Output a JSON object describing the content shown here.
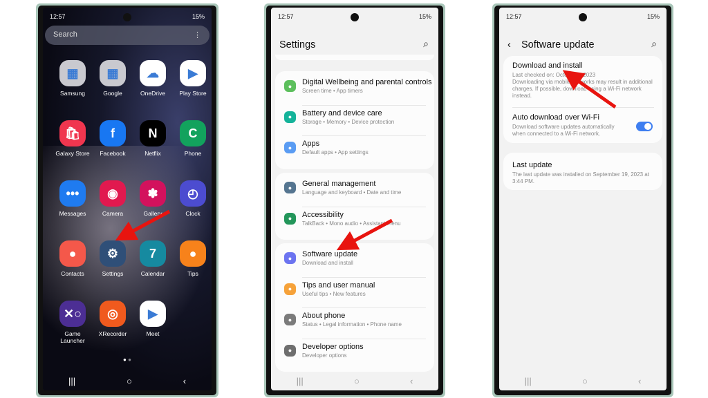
{
  "status": {
    "time": "12:57",
    "battery": "15%"
  },
  "home": {
    "search_placeholder": "Search",
    "apps": [
      {
        "label": "Samsung",
        "color": "#c9c9cf",
        "glyph": "▦"
      },
      {
        "label": "Google",
        "color": "#c9c9cf",
        "glyph": "▦"
      },
      {
        "label": "OneDrive",
        "color": "#ffffff",
        "glyph": "☁"
      },
      {
        "label": "Play Store",
        "color": "#ffffff",
        "glyph": "▶"
      },
      {
        "label": "Galaxy Store",
        "color": "#f0364f",
        "glyph": "🛍"
      },
      {
        "label": "Facebook",
        "color": "#1877f2",
        "glyph": "f"
      },
      {
        "label": "Netflix",
        "color": "#000000",
        "glyph": "N"
      },
      {
        "label": "Phone",
        "color": "#12a25d",
        "glyph": "C"
      },
      {
        "label": "Messages",
        "color": "#1f7bf0",
        "glyph": "•••"
      },
      {
        "label": "Camera",
        "color": "#e1194f",
        "glyph": "◉"
      },
      {
        "label": "Gallery",
        "color": "#d3125d",
        "glyph": "✽"
      },
      {
        "label": "Clock",
        "color": "#4c4cd0",
        "glyph": "◴"
      },
      {
        "label": "Contacts",
        "color": "#f4584a",
        "glyph": "●"
      },
      {
        "label": "Settings",
        "color": "#2f4f78",
        "glyph": "⚙"
      },
      {
        "label": "Calendar",
        "color": "#168aa0",
        "glyph": "7"
      },
      {
        "label": "Tips",
        "color": "#f7821b",
        "glyph": "●"
      },
      {
        "label": "Game Launcher",
        "color": "#4c2e94",
        "glyph": "✕○"
      },
      {
        "label": "XRecorder",
        "color": "#f05a1e",
        "glyph": "◎"
      },
      {
        "label": "Meet",
        "color": "#ffffff",
        "glyph": "▶"
      }
    ]
  },
  "settings": {
    "title": "Settings",
    "groups": [
      [
        {
          "title": "Digital Wellbeing and parental controls",
          "subtitle": "Screen time  •  App timers",
          "color": "#5cbf5c"
        },
        {
          "title": "Battery and device care",
          "subtitle": "Storage  •  Memory  •  Device protection",
          "color": "#14b39a"
        },
        {
          "title": "Apps",
          "subtitle": "Default apps  •  App settings",
          "color": "#5a9cf3"
        }
      ],
      [
        {
          "title": "General management",
          "subtitle": "Language and keyboard  •  Date and time",
          "color": "#557590"
        },
        {
          "title": "Accessibility",
          "subtitle": "TalkBack  •  Mono audio  •  Assistant menu",
          "color": "#23965a"
        }
      ],
      [
        {
          "title": "Software update",
          "subtitle": "Download and install",
          "color": "#6c74f0"
        },
        {
          "title": "Tips and user manual",
          "subtitle": "Useful tips  •  New features",
          "color": "#f6a23a"
        },
        {
          "title": "About phone",
          "subtitle": "Status  •  Legal information  •  Phone name",
          "color": "#7b7b7b"
        },
        {
          "title": "Developer options",
          "subtitle": "Developer options",
          "color": "#6e6e6e"
        }
      ]
    ]
  },
  "software_update": {
    "title": "Software update",
    "download": {
      "title": "Download and install",
      "subtitle": "Last checked on: October 4, 2023\nDownloading via mobile networks may result in additional charges. If possible, download using a Wi-Fi network instead."
    },
    "auto": {
      "title": "Auto download over Wi-Fi",
      "subtitle": "Download software updates automatically when connected to a Wi-Fi network.",
      "enabled": true
    },
    "last": {
      "title": "Last update",
      "subtitle": "The last update was installed on September 19, 2023 at 3:44 PM."
    }
  },
  "accent": "#3e7ef0",
  "arrow_color": "#e8140f"
}
